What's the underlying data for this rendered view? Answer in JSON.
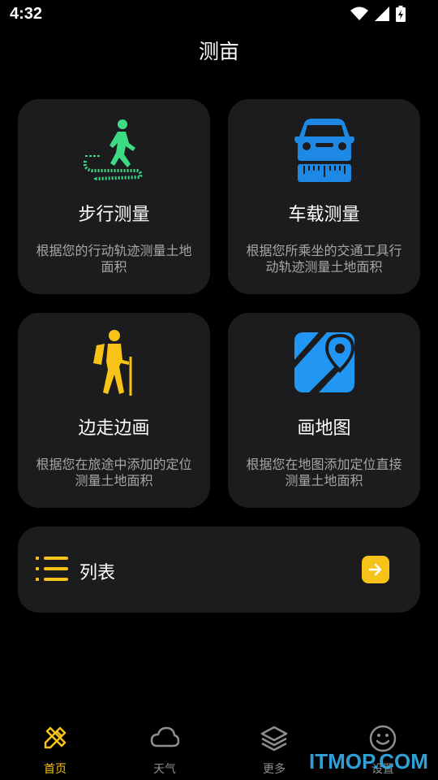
{
  "status": {
    "time": "4:32"
  },
  "title": "测亩",
  "cards": [
    {
      "title": "步行测量",
      "desc": "根据您的行动轨迹测量土地面积",
      "icon": "walking-person-icon"
    },
    {
      "title": "车载测量",
      "desc": "根据您所乘坐的交通工具行动轨迹测量土地面积",
      "icon": "car-ruler-icon"
    },
    {
      "title": "边走边画",
      "desc": "根据您在旅途中添加的定位测量土地面积",
      "icon": "hiker-icon"
    },
    {
      "title": "画地图",
      "desc": "根据您在地图添加定位直接测量土地面积",
      "icon": "map-pin-icon"
    }
  ],
  "list": {
    "label": "列表"
  },
  "tabs": [
    {
      "label": "首页",
      "icon": "pencil-ruler-icon",
      "active": true
    },
    {
      "label": "天气",
      "icon": "cloud-icon",
      "active": false
    },
    {
      "label": "更多",
      "icon": "layers-icon",
      "active": false
    },
    {
      "label": "设置",
      "icon": "smiley-icon",
      "active": false
    }
  ],
  "watermark": "ITMOP.COM",
  "colors": {
    "accent": "#f7c318",
    "card_bg": "#1c1c1e",
    "walk_green": "#3ddc84",
    "car_blue": "#1e88e5",
    "map_blue": "#2196f3"
  }
}
